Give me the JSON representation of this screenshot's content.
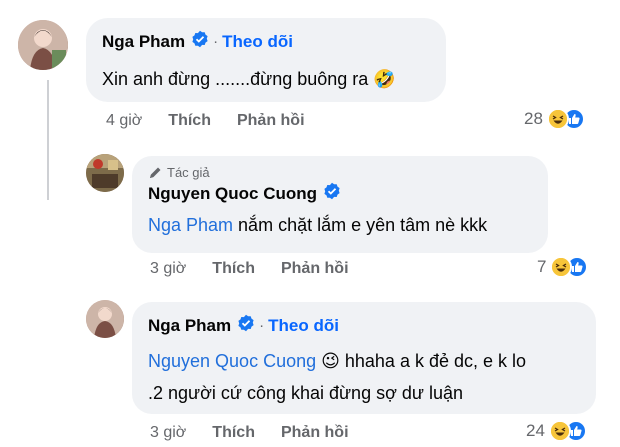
{
  "comments": [
    {
      "name": "Nga Pham",
      "follow": "Theo dõi",
      "text": "Xin anh đừng .......đừng buông ra",
      "emoji": "🤣",
      "time": "4 giờ",
      "like": "Thích",
      "reply": "Phản hồi",
      "reaction_count": "28"
    },
    {
      "author_label": "Tác giả",
      "name": "Nguyen Quoc Cuong",
      "mention": "Nga Pham",
      "text": " nắm chặt lắm e yên tâm nè kkk",
      "time": "3 giờ",
      "like": "Thích",
      "reply": "Phản hồi",
      "reaction_count": "7"
    },
    {
      "name": "Nga Pham",
      "follow": "Theo dõi",
      "mention": "Nguyen Quoc Cuong",
      "emoji": "😉",
      "text_line1": " hhaha a k đẻ dc, e k lo",
      "text_line2": ".2 người cứ công khai đừng sợ dư luận",
      "time": "3 giờ",
      "like": "Thích",
      "reply": "Phản hồi",
      "reaction_count": "24"
    }
  ],
  "colors": {
    "bubble": "#f0f2f5",
    "mention": "#216fdb",
    "follow": "#0866ff",
    "meta": "#65676b",
    "verified": "#1877f2"
  },
  "icons": [
    "verified-badge-icon",
    "pen-icon",
    "haha-reaction-icon",
    "like-reaction-icon"
  ]
}
